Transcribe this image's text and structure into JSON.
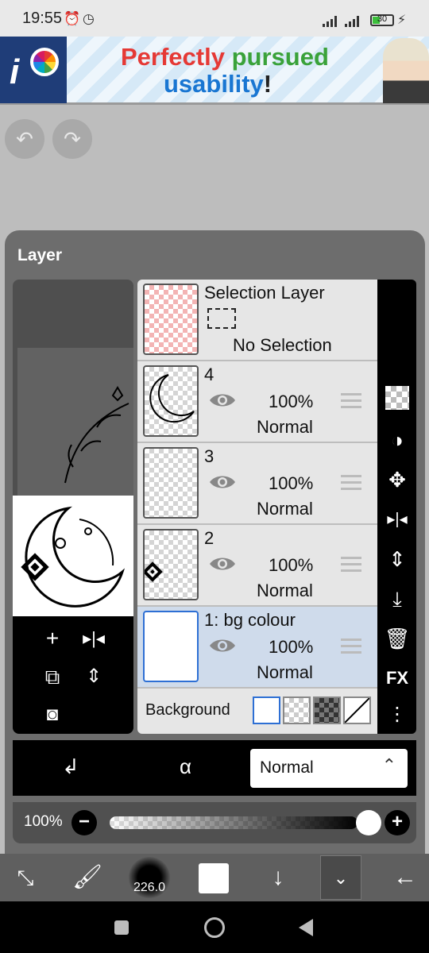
{
  "status": {
    "time": "19:55",
    "battery": "30"
  },
  "banner": {
    "word1": "Perfectly",
    "word2": "pursued",
    "word3": "usability",
    "punct": "!"
  },
  "panel": {
    "title": "Layer",
    "selection_layer": {
      "name": "Selection Layer",
      "state": "No Selection"
    },
    "layers": [
      {
        "name": "4",
        "opacity": "100%",
        "blend": "Normal"
      },
      {
        "name": "3",
        "opacity": "100%",
        "blend": "Normal"
      },
      {
        "name": "2",
        "opacity": "100%",
        "blend": "Normal"
      },
      {
        "name": "1: bg colour",
        "opacity": "100%",
        "blend": "Normal",
        "selected": true
      }
    ],
    "background_label": "Background",
    "blend_mode_value": "Normal",
    "opacity_value": "100%",
    "opacity_fraction": 1.0
  },
  "toolbar": {
    "brush_size": "226.0"
  },
  "icons": [
    "undo-icon",
    "redo-icon",
    "add-layer-icon",
    "flip-icon",
    "duplicate-icon",
    "camera-icon",
    "transparency-icon",
    "move-icon",
    "trash-icon",
    "fx-icon",
    "more-icon",
    "clip-icon",
    "alpha-lock-icon",
    "brush-icon",
    "arrow-down-icon",
    "back-icon"
  ],
  "colors": {
    "selected_row": "#cfdbeb",
    "accent": "#2d6fd4",
    "selection_checker": "#f3b4b4"
  }
}
